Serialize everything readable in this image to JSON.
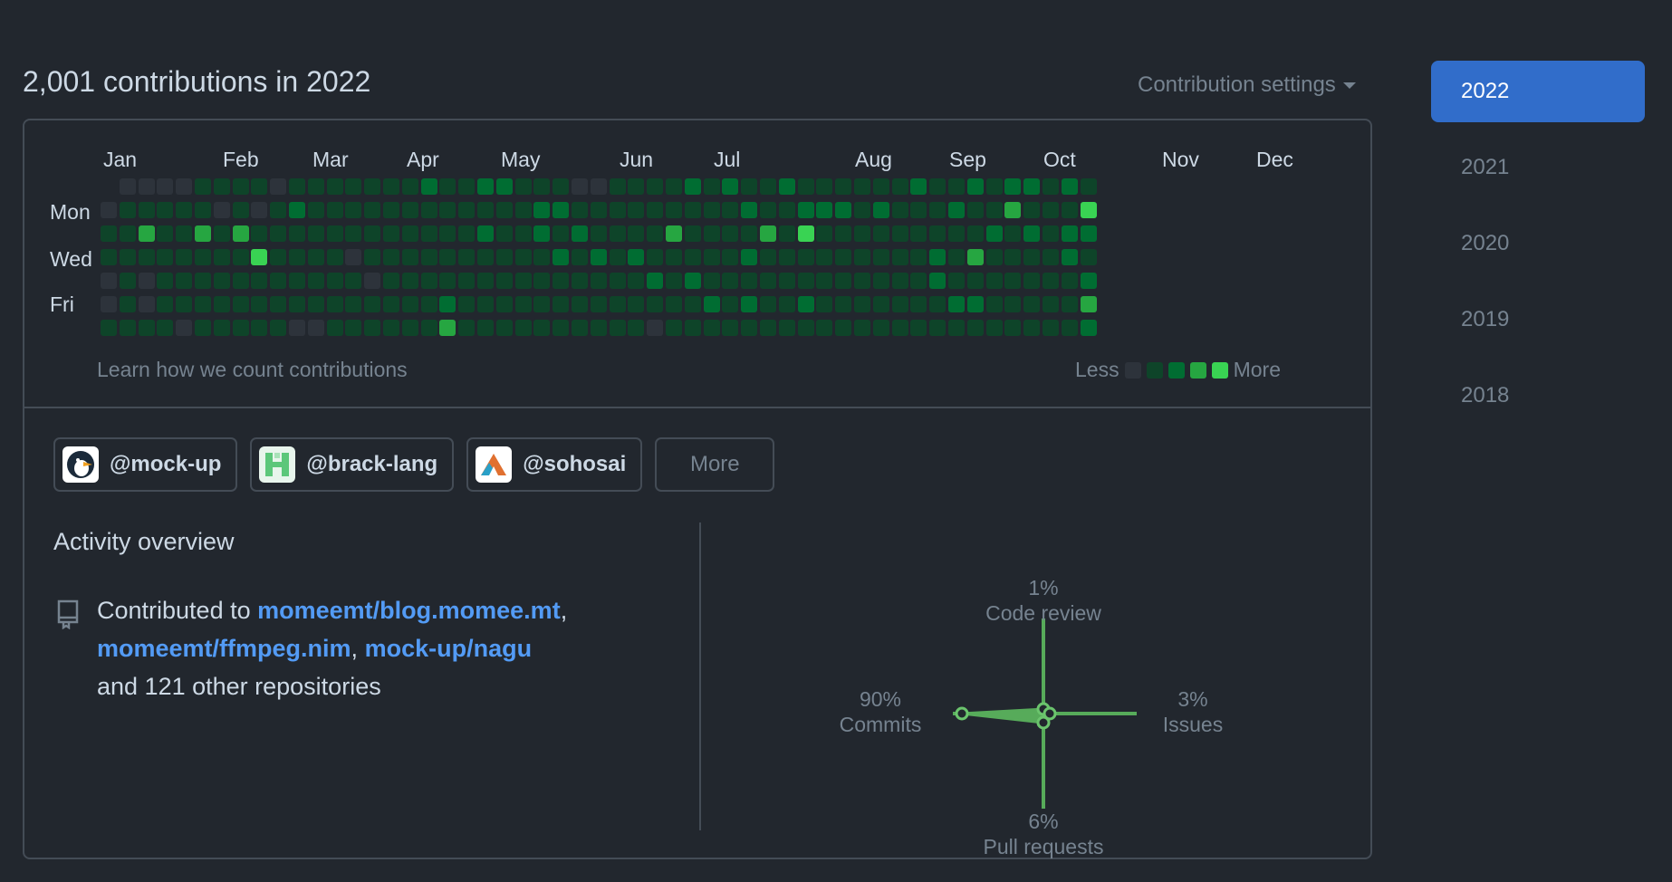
{
  "header": {
    "title": "2,001 contributions in 2022",
    "settings_label": "Contribution settings"
  },
  "calendar": {
    "months": [
      "Jan",
      "Feb",
      "Mar",
      "Apr",
      "May",
      "Jun",
      "Jul",
      "Aug",
      "Sep",
      "Oct",
      "Nov",
      "Dec"
    ],
    "days": [
      "Mon",
      "Wed",
      "Fri"
    ],
    "learn_link": "Learn how we count contributions",
    "legend_less": "Less",
    "legend_more": "More",
    "level_colors": [
      "#2d333b",
      "#0e4429",
      "#006d32",
      "#26a641",
      "#39d353"
    ],
    "weeks": 53,
    "levels": [
      "0000000111111111111111111111111111111111111111111111",
      "1111111111111111111111111111111111111111111111111111",
      "1121121111111111111111111111111111111111111111111111",
      "1111111131111111111111111111111111111111111111111111",
      "1111111111111111111111111111111111111111111111111111",
      "1111111111111111111111111111111111111111111111111111",
      "1111111111111111111111111111111111111111111111111111"
    ]
  },
  "orgs": {
    "items": [
      {
        "handle": "@mock-up",
        "icon": "penguin-avatar-icon"
      },
      {
        "handle": "@brack-lang",
        "icon": "brack-avatar-icon"
      },
      {
        "handle": "@sohosai",
        "icon": "sohosai-avatar-icon"
      }
    ],
    "more_label": "More"
  },
  "activity": {
    "title": "Activity overview",
    "prefix": "Contributed to",
    "repos": [
      "momeemt/blog.momee.mt",
      "momeemt/ffmpeg.nim",
      "mock-up/nagu"
    ],
    "suffix": "and 121 other repositories"
  },
  "breakdown": {
    "code_review": {
      "pct": "1%",
      "label": "Code review",
      "value": 1
    },
    "issues": {
      "pct": "3%",
      "label": "Issues",
      "value": 3
    },
    "pull_requests": {
      "pct": "6%",
      "label": "Pull requests",
      "value": 6
    },
    "commits": {
      "pct": "90%",
      "label": "Commits",
      "value": 90
    }
  },
  "years": [
    "2022",
    "2021",
    "2020",
    "2019",
    "2018"
  ],
  "selected_year": "2022"
}
